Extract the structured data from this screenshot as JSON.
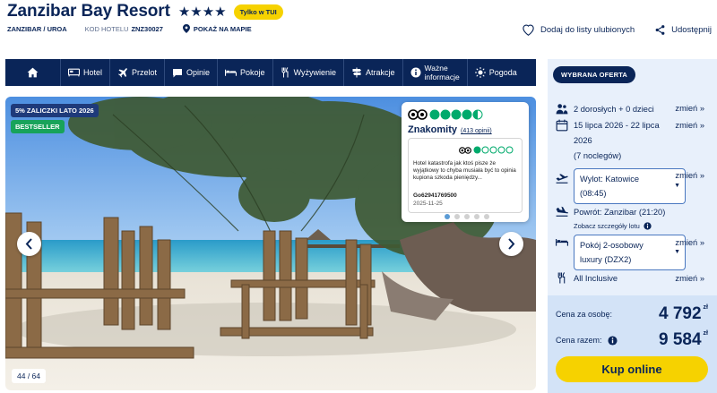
{
  "hotel": {
    "name": "Zanzibar Bay Resort",
    "stars": "★★★★",
    "badge": "Tylko w TUI",
    "location": "ZANZIBAR / UROA",
    "code_label": "KOD HOTELU",
    "code": "ZNZ30027",
    "map_link": "POKAŻ NA MAPIE"
  },
  "actions": {
    "favorite": "Dodaj do listy ulubionych",
    "share": "Udostępnij"
  },
  "nav": {
    "items": [
      {
        "label": "",
        "icon": "home-icon"
      },
      {
        "label": "Hotel",
        "icon": "bed-icon"
      },
      {
        "label": "Przelot",
        "icon": "plane-icon"
      },
      {
        "label": "Opinie",
        "icon": "chat-icon"
      },
      {
        "label": "Pokoje",
        "icon": "room-icon"
      },
      {
        "label": "Wyżywienie",
        "icon": "cutlery-icon"
      },
      {
        "label": "Atrakcje",
        "icon": "signpost-icon"
      },
      {
        "label": "Ważne informacje",
        "icon": "info-icon"
      },
      {
        "label": "Pogoda",
        "icon": "sun-icon"
      }
    ],
    "important_line1": "Ważne",
    "important_line2": "informacje"
  },
  "gallery": {
    "promo": "5% ZALICZKI LATO 2026",
    "bestseller": "BESTSELLER",
    "counter": "44 / 64",
    "dots_total": 5,
    "dots_active": 1
  },
  "review": {
    "rating_bubbles": 4.5,
    "title": "Znakomity",
    "count": "(413 opinii)",
    "quote_rating": 1,
    "quote_text": "Hotel katastrofa jak ktoś pisze że wyjątkowy to chyba musiała być to opinia kupiona szkoda pieniędzy...",
    "author": "Go62941769500",
    "date": "2025-11-25"
  },
  "offer": {
    "tag": "WYBRANA OFERTA",
    "travellers": "2 dorosłych + 0 dzieci",
    "dates_line1": "15 lipca 2026 - 22 lipca",
    "dates_line2": "2026",
    "nights": "(7 noclegów)",
    "departure_line1": "Wylot: Katowice",
    "departure_line2": "(08:45)",
    "return": "Powrót: Zanzibar (21:20)",
    "flight_details": "Zobacz szczegóły lotu",
    "room_line1": "Pokój 2-osobowy",
    "room_line2": "luxury (DZX2)",
    "board": "All Inclusive",
    "change": "zmień",
    "price_per_person_label": "Cena za osobę:",
    "price_per_person": "4 792",
    "price_total_label": "Cena razem:",
    "price_total": "9 584",
    "currency": "zł",
    "book_button": "Kup online"
  },
  "colors": {
    "navy": "#0a2558",
    "yellow": "#f6d200",
    "green": "#18a35a",
    "panel": "#e8f0fb",
    "tripadvisor_green": "#00aa6c"
  }
}
